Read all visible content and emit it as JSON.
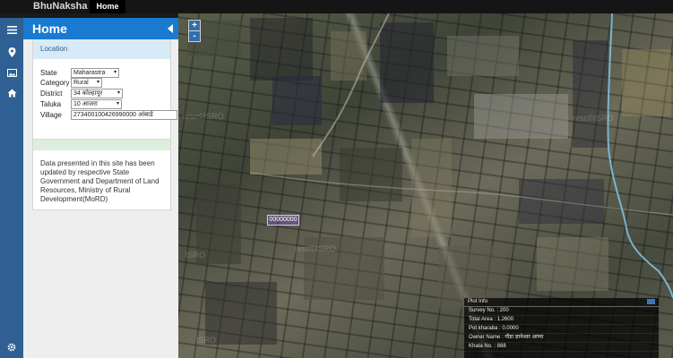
{
  "topbar": {
    "brand": "BhuNaksha",
    "active_tab": "Home"
  },
  "sidebar": {
    "icons": [
      "menu-icon",
      "map-marker-icon",
      "image-icon",
      "home-icon",
      "settings-icon"
    ]
  },
  "panel": {
    "title": "Home",
    "location": {
      "header": "Location",
      "state_label": "State",
      "state_value": "Maharastra",
      "category_label": "Category",
      "category_value": "Rural",
      "district_label": "District",
      "district_value": "34 कोल्हापूर",
      "taluka_label": "Taluka",
      "taluka_value": "10 आजरा",
      "village_label": "Village",
      "village_value": "273400100426990000 आंबाडे"
    },
    "notice": "Data presented in this site has been updated by respective State Government and Department of Land Resources, Ministry of Rural Development(MoRD)"
  },
  "map": {
    "zoom_in": "+",
    "zoom_out": "-",
    "plot_label": "00000000",
    "watermarks": [
      "nrsc©ISRO",
      "ISRO",
      "nrsc©ISRO",
      "ISRO",
      "nrsc©ISRO"
    ]
  },
  "plot_info": {
    "title": "Plot Info",
    "survey": "Survey No. : 200",
    "area": "Total Area : 1.2600",
    "pot": "Pot kharaba : 0.0000",
    "owner": "Owner Name : गौडा ज्ञानेश्वर आप्पा",
    "khata": "Khata No. : 888"
  },
  "colors": {
    "header_blue": "#1a7ad0",
    "sidebar_blue": "#2f5f93",
    "topbar": "#151515"
  }
}
